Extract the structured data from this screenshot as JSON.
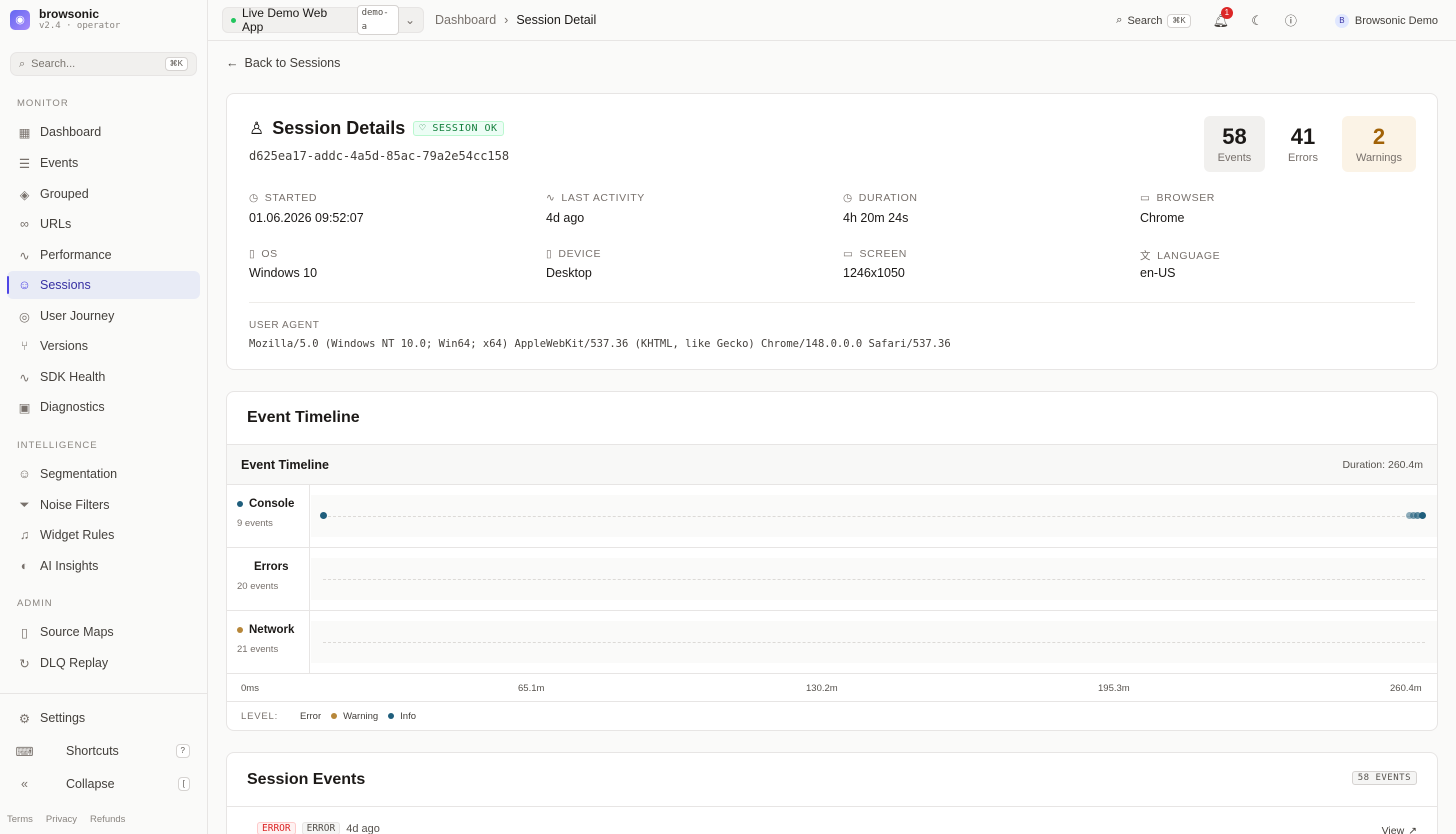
{
  "brand": {
    "name": "browsonic",
    "version": "v2.4 · operator"
  },
  "sidebar": {
    "search_placeholder": "Search...",
    "search_kbd": "⌘K",
    "sections": {
      "monitor": "MONITOR",
      "intelligence": "INTELLIGENCE",
      "admin": "ADMIN"
    },
    "items": [
      "Dashboard",
      "Events",
      "Grouped",
      "URLs",
      "Performance",
      "Sessions",
      "User Journey",
      "Versions",
      "SDK Health",
      "Diagnostics",
      "Segmentation",
      "Noise Filters",
      "Widget Rules",
      "AI Insights",
      "Source Maps",
      "DLQ Replay"
    ],
    "settings": "Settings",
    "shortcuts": "Shortcuts",
    "shortcuts_kbd": "?",
    "collapse": "Collapse",
    "collapse_kbd": "[",
    "footer": [
      "Terms",
      "Privacy",
      "Refunds"
    ]
  },
  "topbar": {
    "app_name": "Live Demo Web App",
    "app_tag": "demo-a",
    "breadcrumb": [
      "Dashboard",
      "Session Detail"
    ],
    "search_label": "Search",
    "search_kbd": "⌘K",
    "notif_count": "1",
    "user_initial": "B",
    "user_name": "Browsonic Demo"
  },
  "back_label": "Back to Sessions",
  "session": {
    "title": "Session Details",
    "status": "SESSION OK",
    "id": "d625ea17-addc-4a5d-85ac-79a2e54cc158",
    "stats": [
      {
        "value": "58",
        "label": "Events"
      },
      {
        "value": "41",
        "label": "Errors"
      },
      {
        "value": "2",
        "label": "Warnings"
      }
    ],
    "meta": [
      {
        "label": "STARTED",
        "value": "01.06.2026 09:52:07"
      },
      {
        "label": "LAST ACTIVITY",
        "value": "4d ago"
      },
      {
        "label": "DURATION",
        "value": "4h 20m 24s"
      },
      {
        "label": "BROWSER",
        "value": "Chrome"
      },
      {
        "label": "OS",
        "value": "Windows 10"
      },
      {
        "label": "DEVICE",
        "value": "Desktop"
      },
      {
        "label": "SCREEN",
        "value": "1246x1050"
      },
      {
        "label": "LANGUAGE",
        "value": "en-US"
      }
    ],
    "user_agent_label": "USER AGENT",
    "user_agent": "Mozilla/5.0 (Windows NT 10.0; Win64; x64) AppleWebKit/537.36 (KHTML, like Gecko) Chrome/148.0.0.0 Safari/537.36"
  },
  "timeline": {
    "card_title": "Event Timeline",
    "inner_title": "Event Timeline",
    "duration": "Duration: 260.4m",
    "rows": [
      {
        "name": "Console",
        "count": "9 events"
      },
      {
        "name": "Errors",
        "count": "20 events"
      },
      {
        "name": "Network",
        "count": "21 events"
      }
    ],
    "axis": [
      "0ms",
      "65.1m",
      "130.2m",
      "195.3m",
      "260.4m"
    ],
    "level_label": "LEVEL:",
    "levels": [
      "Error",
      "Warning",
      "Info"
    ],
    "colors": {
      "info": "#1f5e7c",
      "warning": "#b7873a",
      "error": "#dc2626"
    }
  },
  "events": {
    "title": "Session Events",
    "count_badge": "58 EVENTS",
    "first": {
      "level": "ERROR",
      "type": "ERROR",
      "time": "4d ago",
      "action": "View"
    }
  }
}
